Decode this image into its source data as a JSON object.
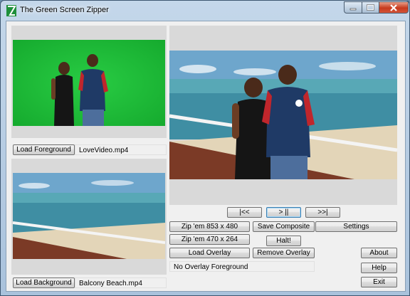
{
  "window": {
    "title": "The Green Screen Zipper",
    "icon": "zipper-app-icon"
  },
  "foreground": {
    "load_label": "Load Foreground",
    "file_name": "LoveVideo.mp4"
  },
  "background": {
    "load_label": "Load Background",
    "file_name": "Balcony Beach.mp4"
  },
  "transport": {
    "first_label": "|<<",
    "play_pause_label": "> ||",
    "last_label": ">>|"
  },
  "actions": {
    "zip_large_label": "Zip 'em 853 x 480",
    "zip_small_label": "Zip 'em 470 x 264",
    "save_composite_label": "Save Composite",
    "halt_label": "Halt!",
    "settings_label": "Settings",
    "load_overlay_label": "Load Overlay",
    "remove_overlay_label": "Remove Overlay",
    "overlay_status": "No Overlay Foreground",
    "about_label": "About",
    "help_label": "Help",
    "exit_label": "Exit"
  },
  "colors": {
    "green_screen": "#1fc33a",
    "sky": "#6ea6cc",
    "sea": "#3f8ea3",
    "sand": "#e3d5b8"
  }
}
